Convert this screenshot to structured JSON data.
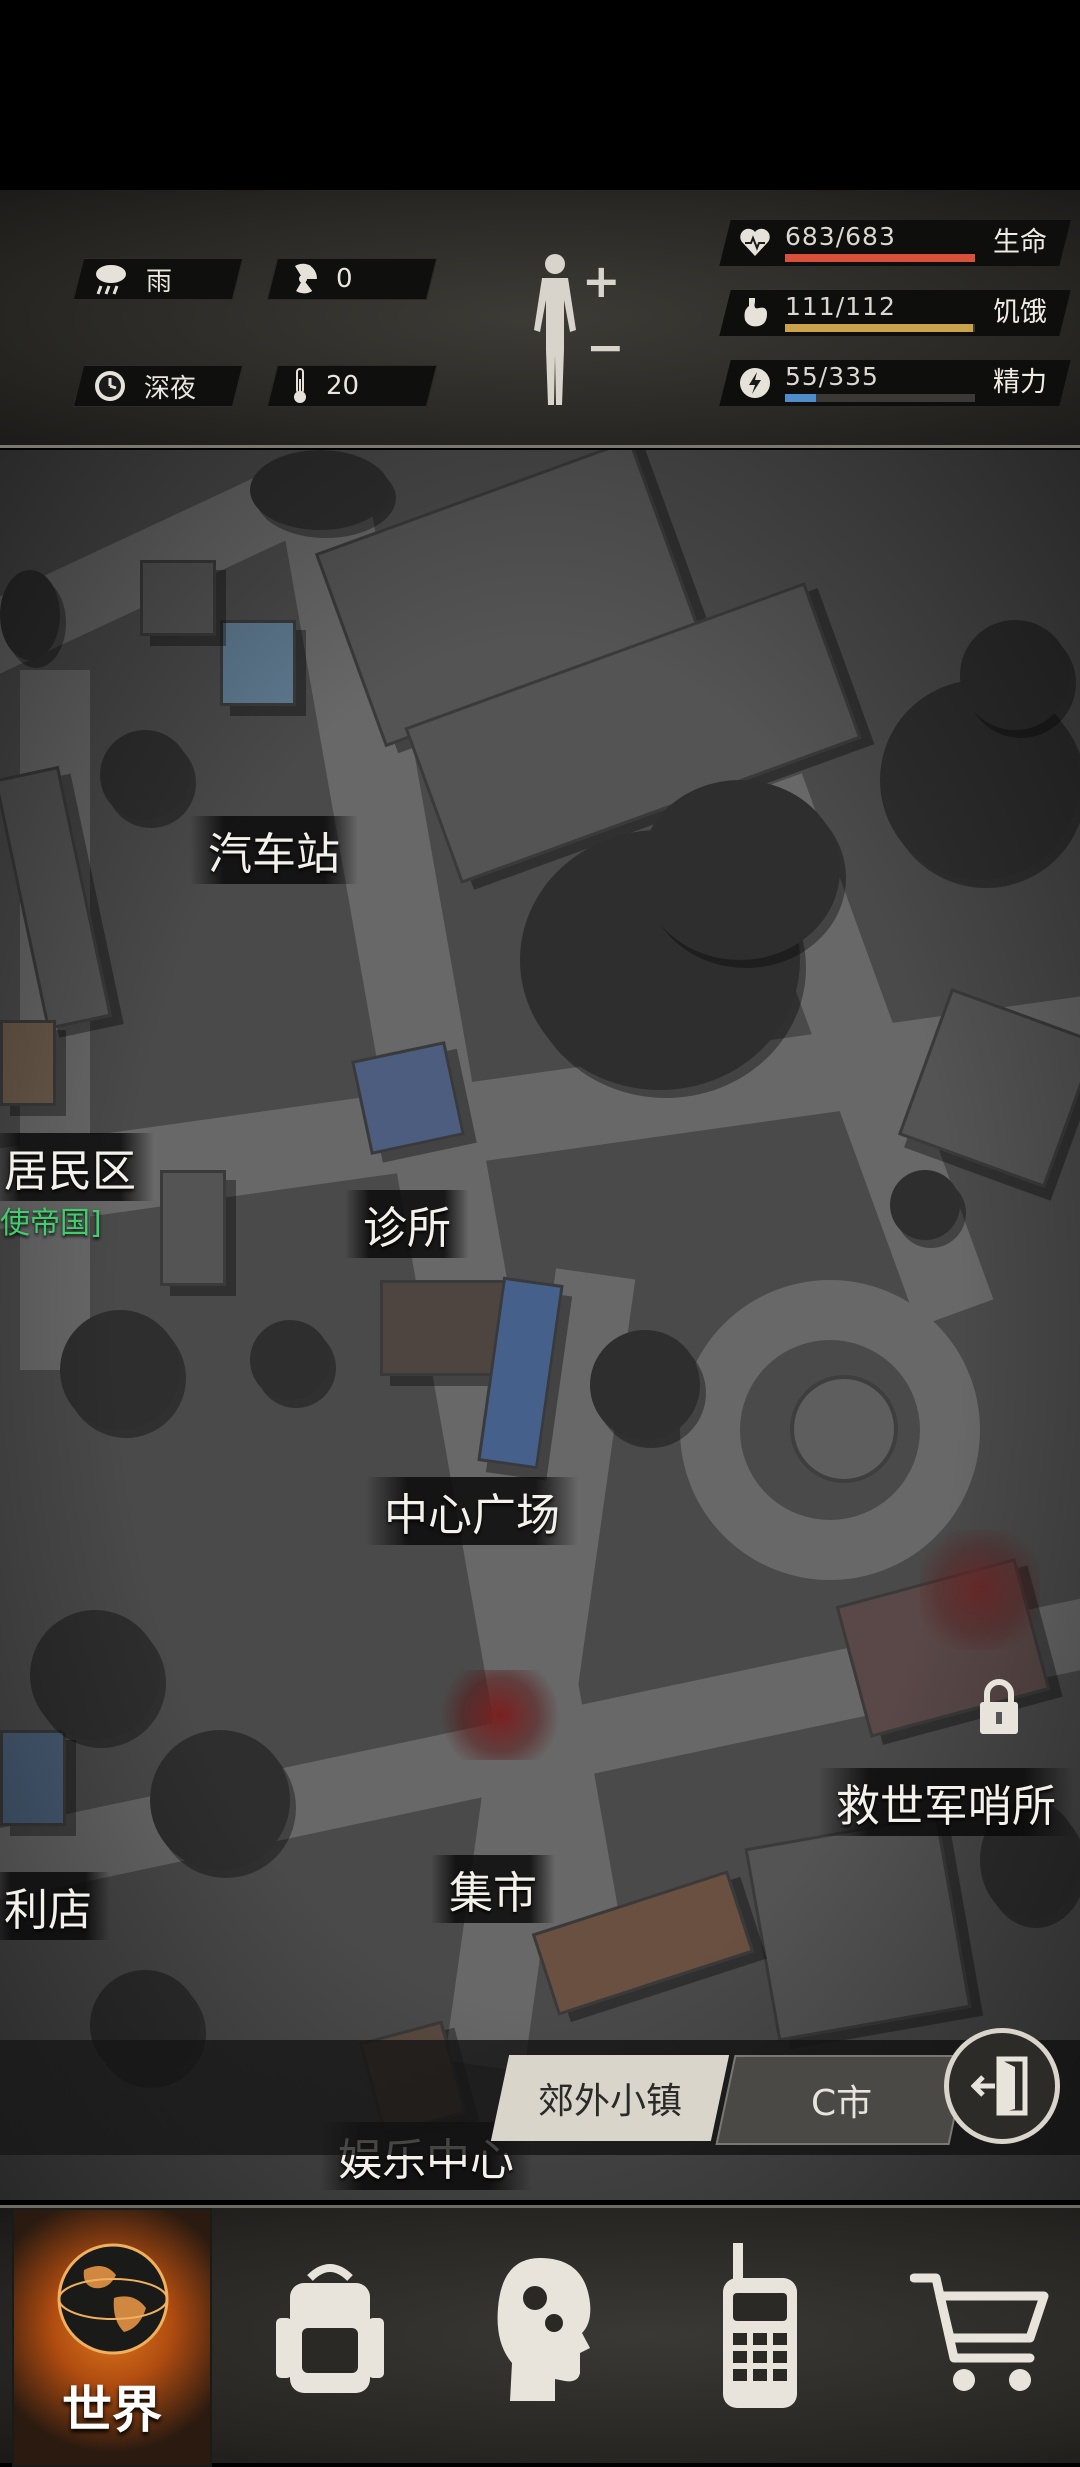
{
  "status": {
    "weather": {
      "icon": "rain-cloud-icon",
      "label": "雨"
    },
    "radiation": {
      "icon": "radiation-icon",
      "value": "0"
    },
    "time": {
      "icon": "clock-icon",
      "label": "深夜"
    },
    "temperature": {
      "icon": "thermometer-icon",
      "value": "20"
    },
    "body_toggle": {
      "plus": "+",
      "minus": "−"
    },
    "vitals": [
      {
        "key": "health",
        "icon": "heart-icon",
        "text": "683/683",
        "label": "生命",
        "fraction": 1.0,
        "color": "#d9513b"
      },
      {
        "key": "hunger",
        "icon": "stomach-icon",
        "text": "111/112",
        "label": "饥饿",
        "fraction": 0.99,
        "color": "#c9a24a"
      },
      {
        "key": "energy",
        "icon": "energy-icon",
        "text": "55/335",
        "label": "精力",
        "fraction": 0.164,
        "color": "#4f8cc9"
      }
    ]
  },
  "map": {
    "locations": {
      "bus_station": "汽车站",
      "residential": "居民区",
      "faction_tag": "使帝国]",
      "clinic": "诊所",
      "central_square": "中心广场",
      "outpost": "救世军哨所",
      "market": "集市",
      "store": "利店",
      "entertainment": "娱乐中心"
    },
    "region_tabs": {
      "active": "郊外小镇",
      "other": "C市"
    },
    "exit_icon": "exit-door-icon",
    "lock_icon": "lock-icon"
  },
  "nav": {
    "world": "世界",
    "items": [
      "globe-icon",
      "backpack-icon",
      "skills-head-icon",
      "radio-icon",
      "shopping-cart-icon"
    ]
  },
  "colors": {
    "accent_orange": "#e07a1f",
    "faction_green": "#3fcf6a"
  }
}
